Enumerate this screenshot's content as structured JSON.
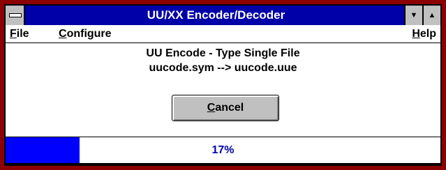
{
  "window": {
    "title": "UU/XX Encoder/Decoder",
    "system_menu_icon": "system-menu-bar-icon",
    "minimize_glyph": "▼",
    "maximize_glyph": "▲"
  },
  "menu": {
    "file": {
      "first": "F",
      "rest": "ile"
    },
    "configure": {
      "first": "C",
      "rest": "onfigure"
    },
    "help": {
      "first": "H",
      "rest": "elp"
    }
  },
  "status": {
    "line1": "UU Encode - Type Single File",
    "line2": "uucode.sym --> uucode.uue"
  },
  "buttons": {
    "cancel": {
      "first": "C",
      "rest": "ancel"
    }
  },
  "progress": {
    "value": 0.17,
    "label": "17%"
  },
  "colors": {
    "frame": "#8b0000",
    "titlebar": "#0000a8",
    "progress_fill": "#0000ff",
    "progress_text": "#0000a8",
    "button_face": "#c0c0c0"
  }
}
